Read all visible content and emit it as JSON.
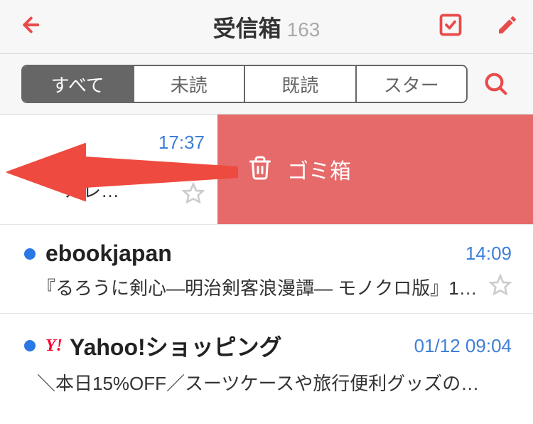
{
  "header": {
    "title": "受信箱",
    "count": "163"
  },
  "filters": {
    "all": "すべて",
    "unread": "未読",
    "read": "既読",
    "starred": "スター"
  },
  "swipe_action": {
    "label": "ゴミ箱",
    "row_time": "17:37",
    "row_subject_fragment": "カレ…"
  },
  "rows": [
    {
      "sender": "ebookjapan",
      "time": "14:09",
      "subject": "『るろうに剣心―明治剣客浪漫譚― モノクロ版』1…"
    },
    {
      "sender": "Yahoo!ショッピング",
      "brand": "Y!",
      "time": "01/12 09:04",
      "subject": "＼本日15%OFF／スーツケースや旅行便利グッズの…"
    }
  ],
  "colors": {
    "accent": "#e94b4b",
    "swipe_bg": "#e66a6a",
    "link_blue": "#3f7fd8",
    "unread_dot": "#2b77e6"
  }
}
